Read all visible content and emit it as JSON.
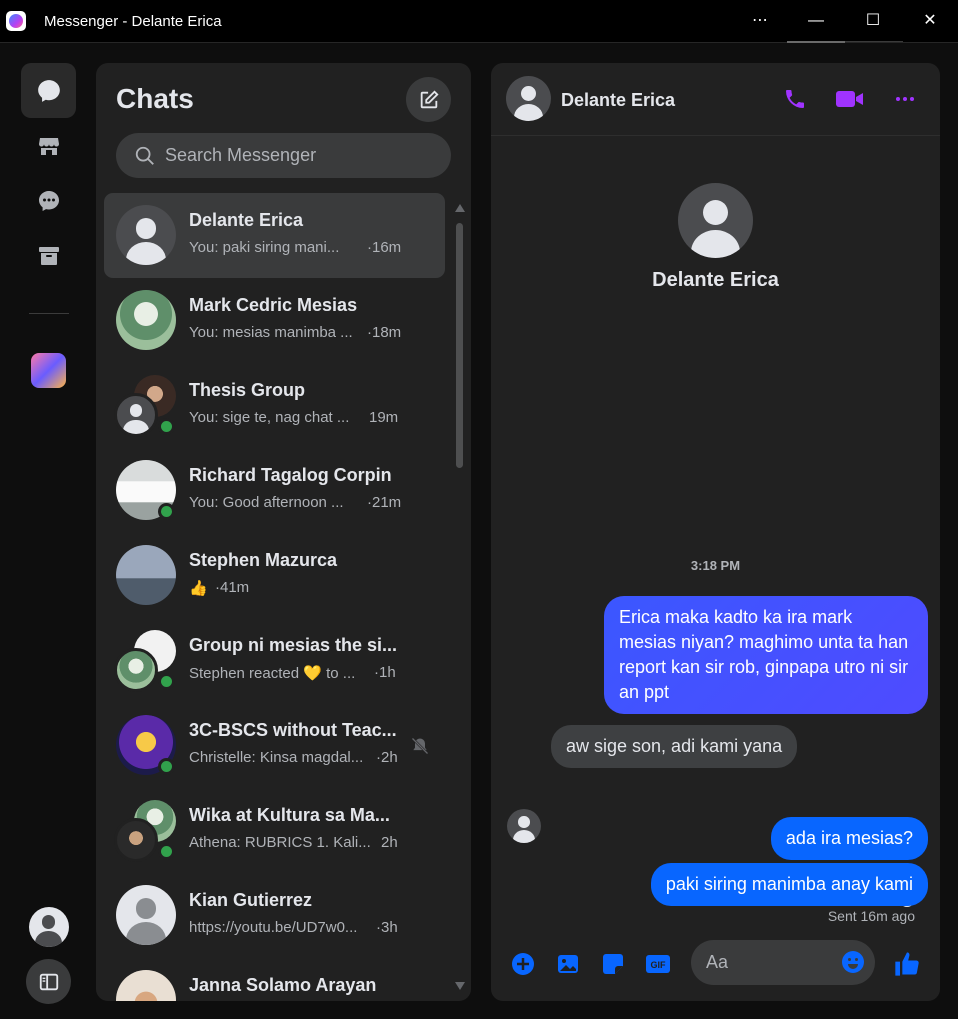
{
  "window": {
    "title": "Messenger - Delante Erica",
    "more_label": "⋯",
    "minimize_label": "—",
    "maximize_label": "☐",
    "close_label": "✕"
  },
  "colors": {
    "accent": "#0866ff",
    "purple_accent": "#a033ff",
    "online": "#31a24c"
  },
  "rail": {
    "items": [
      "chats-icon",
      "marketplace-icon",
      "message-requests-icon",
      "archive-icon",
      "community-icon"
    ]
  },
  "list": {
    "title": "Chats",
    "search_placeholder": "Search Messenger",
    "chats": [
      {
        "name": "Delante Erica",
        "preview": "You: paki siring mani...",
        "time": "·16m",
        "active": true,
        "online": false
      },
      {
        "name": "Mark Cedric Mesias",
        "preview": "You: mesias manimba ...",
        "time": "·18m",
        "online": false
      },
      {
        "name": "Thesis Group",
        "preview": "You: sige te, nag chat ...",
        "time": "19m",
        "online": true
      },
      {
        "name": "Richard Tagalog Corpin",
        "preview": "You: Good afternoon ...",
        "time": "·21m",
        "online": true
      },
      {
        "name": "Stephen Mazurca",
        "preview": "👍",
        "time": "·41m",
        "online": false
      },
      {
        "name": "Group ni mesias the si...",
        "preview": "Stephen reacted 💛 to ...",
        "time": "·1h",
        "online": true
      },
      {
        "name": "3C-BSCS without Teac...",
        "preview": "Christelle: Kinsa magdal...",
        "time": "·2h",
        "online": true,
        "muted": true
      },
      {
        "name": "Wika at Kultura sa Ma...",
        "preview": "Athena: RUBRICS 1. Kali...",
        "time": "2h",
        "online": true
      },
      {
        "name": "Kian Gutierrez",
        "preview": "https://youtu.be/UD7w0...",
        "time": "·3h",
        "online": false
      },
      {
        "name": "Janna Solamo Arayan",
        "preview": "",
        "time": "",
        "online": false
      }
    ]
  },
  "conversation": {
    "contact_name": "Delante Erica",
    "profile_name": "Delante Erica",
    "timestamp": "3:18 PM",
    "messages": [
      {
        "from": "me",
        "text": "Erica maka kadto ka ira mark mesias niyan? maghimo unta ta han report kan sir rob, ginpapa utro ni sir an ppt"
      },
      {
        "from": "them",
        "text": "aw sige son, adi kami yana"
      },
      {
        "from": "me",
        "text": "ada ira mesias?"
      },
      {
        "from": "me",
        "text": "paki siring manimba anay kami"
      }
    ],
    "status": "Sent 16m ago",
    "composer_placeholder": "Aa"
  }
}
